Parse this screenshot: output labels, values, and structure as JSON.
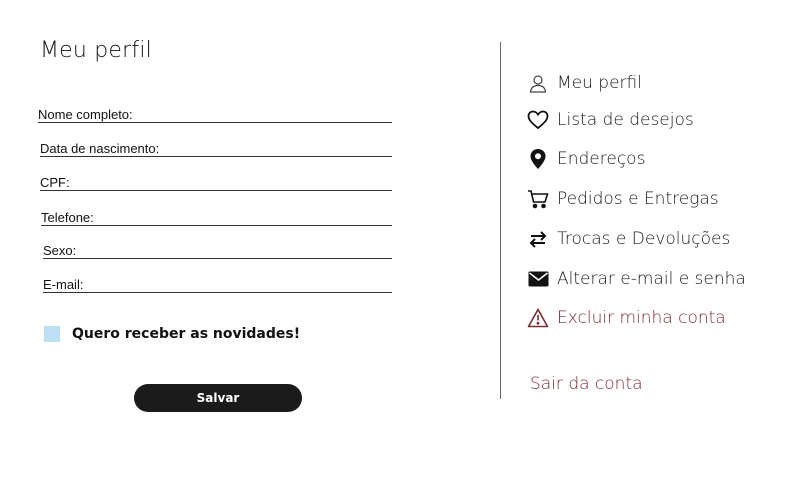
{
  "page": {
    "title": "Meu perfil"
  },
  "form": {
    "fields": [
      {
        "label": "Nome completo:",
        "value": ""
      },
      {
        "label": "Data de nascimento:",
        "value": ""
      },
      {
        "label": "CPF:",
        "value": ""
      },
      {
        "label": "Telefone:",
        "value": ""
      },
      {
        "label": "Sexo:",
        "value": ""
      },
      {
        "label": "E-mail:",
        "value": ""
      }
    ],
    "newsletter_label": "Quero receber as novidades!",
    "newsletter_checked": false,
    "save_label": "Salvar"
  },
  "sidebar": {
    "items": [
      {
        "label": "Meu perfil",
        "icon": "user-icon"
      },
      {
        "label": "Lista de desejos",
        "icon": "heart-icon"
      },
      {
        "label": "Endereços",
        "icon": "location-pin-icon"
      },
      {
        "label": "Pedidos e Entregas",
        "icon": "cart-icon"
      },
      {
        "label": "Trocas e Devoluções",
        "icon": "exchange-arrows-icon"
      },
      {
        "label": "Alterar e-mail e senha",
        "icon": "envelope-icon"
      },
      {
        "label": "Excluir minha conta",
        "icon": "warning-icon"
      }
    ],
    "logout_label": "Sair da conta"
  },
  "colors": {
    "accent_danger": "#7a2a33",
    "checkbox_fill": "#bcdff4",
    "button_bg": "#1b1b1b"
  }
}
